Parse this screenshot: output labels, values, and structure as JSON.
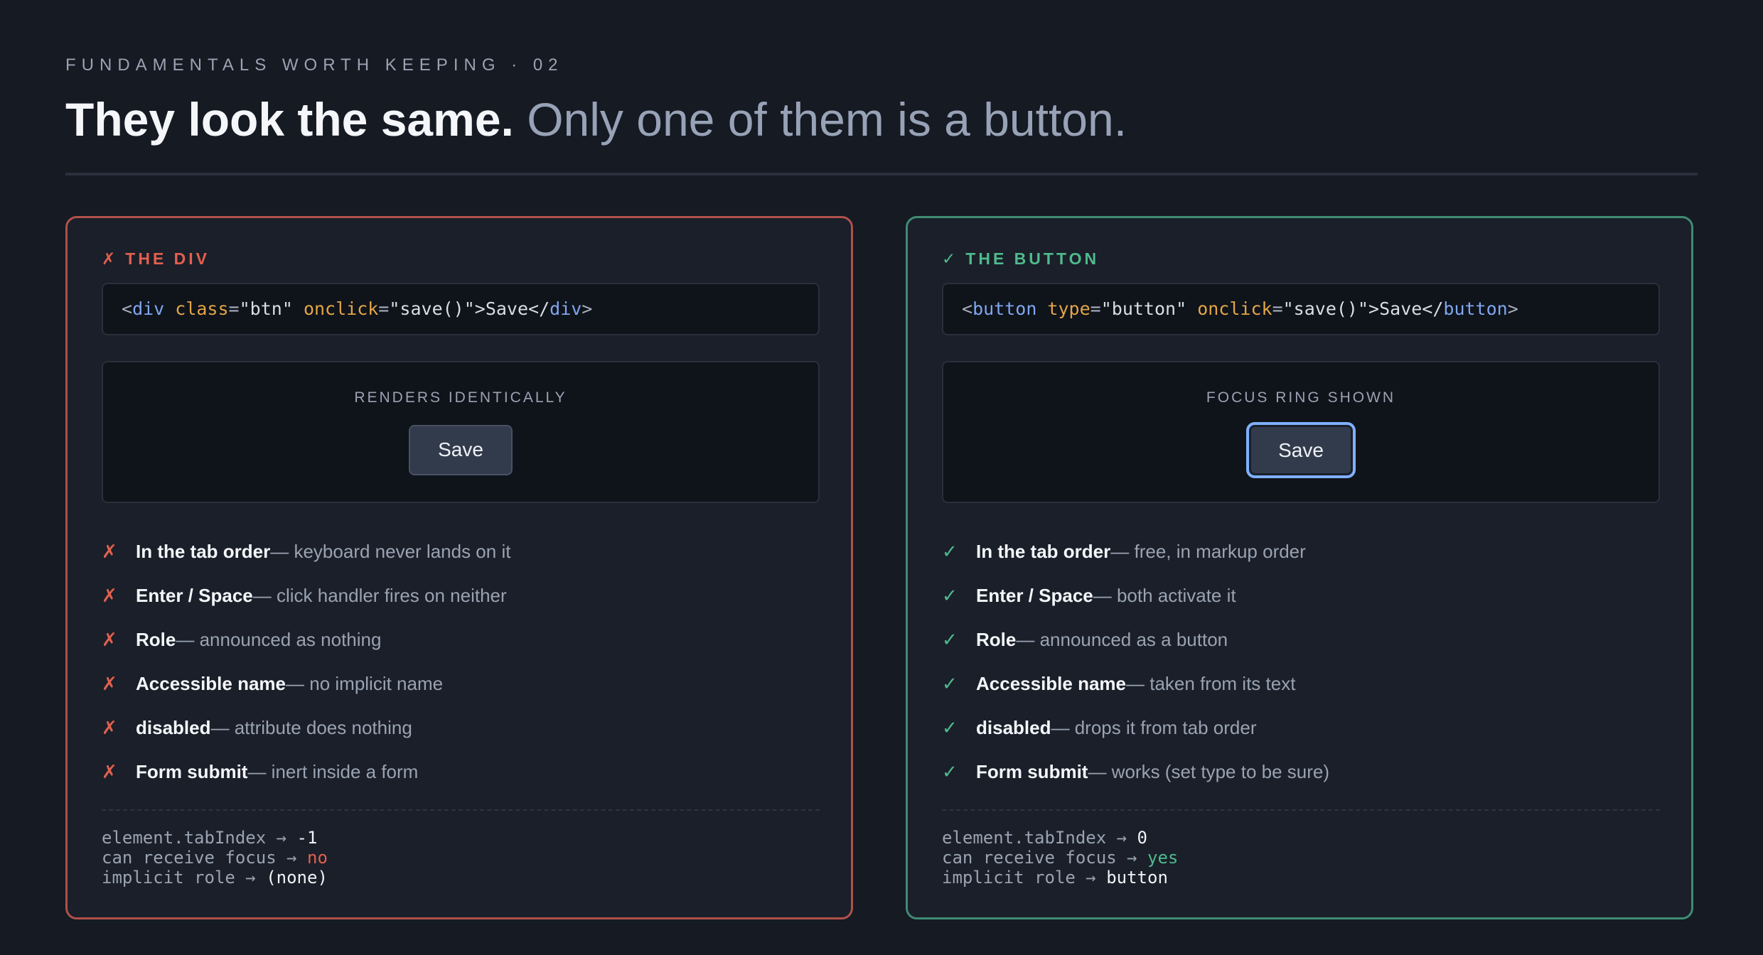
{
  "eyebrow": "FUNDAMENTALS WORTH KEEPING · 02",
  "headline": {
    "strong": "They look the same.",
    "soft": "Only one of them is a button."
  },
  "colors": {
    "bad": "#e2604f",
    "good": "#4fba8c",
    "focus_ring": "#7fb0ff",
    "background": "#151a23"
  },
  "div_card": {
    "mark": "✗",
    "title": "THE DIV",
    "code": {
      "open_lt": "<",
      "tag": "div",
      "attr1": "class",
      "eq1": "=",
      "val1": "\"btn\"",
      "attr2": "onclick",
      "eq2": "=",
      "val2": "\"save()\"",
      "text": ">Save</",
      "tag_close": "div",
      "end": ">"
    },
    "preview_label": "RENDERS IDENTICALLY",
    "demo_button": "Save",
    "checks": [
      {
        "mark": "✗",
        "term": "In the tab order",
        "desc": " — keyboard never lands on it"
      },
      {
        "mark": "✗",
        "term": "Enter / Space",
        "desc": " — click handler fires on neither"
      },
      {
        "mark": "✗",
        "term": "Role",
        "desc": " — announced as nothing"
      },
      {
        "mark": "✗",
        "term": "Accessible name",
        "desc": " — no implicit name"
      },
      {
        "mark": "✗",
        "term": "disabled",
        "desc": " — attribute does nothing"
      },
      {
        "mark": "✗",
        "term": "Form submit",
        "desc": " — inert inside a form"
      }
    ],
    "facts": [
      {
        "key": "element.tabIndex",
        "arrow": " → ",
        "value": "-1"
      },
      {
        "key": "can receive focus",
        "arrow": " → ",
        "value": "no"
      },
      {
        "key": "implicit role",
        "arrow": " → ",
        "value": "(none)"
      }
    ]
  },
  "button_card": {
    "mark": "✓",
    "title": "THE BUTTON",
    "code": {
      "open_lt": "<",
      "tag": "button",
      "attr1": "type",
      "eq1": "=",
      "val1": "\"button\"",
      "attr2": "onclick",
      "eq2": "=",
      "val2": "\"save()\"",
      "text": ">Save</",
      "tag_close": "button",
      "end": ">"
    },
    "preview_label": "FOCUS RING SHOWN",
    "demo_button": "Save",
    "checks": [
      {
        "mark": "✓",
        "term": "In the tab order",
        "desc": " — free, in markup order"
      },
      {
        "mark": "✓",
        "term": "Enter / Space",
        "desc": " — both activate it"
      },
      {
        "mark": "✓",
        "term": "Role",
        "desc": " — announced as a button"
      },
      {
        "mark": "✓",
        "term": "Accessible name",
        "desc": " — taken from its text"
      },
      {
        "mark": "✓",
        "term": "disabled",
        "desc": " — drops it from tab order"
      },
      {
        "mark": "✓",
        "term": "Form submit",
        "desc": " — works (set type to be sure)"
      }
    ],
    "facts": [
      {
        "key": "element.tabIndex",
        "arrow": " → ",
        "value": "0"
      },
      {
        "key": "can receive focus",
        "arrow": " → ",
        "value": "yes"
      },
      {
        "key": "implicit role",
        "arrow": " → ",
        "value": "button"
      }
    ]
  }
}
